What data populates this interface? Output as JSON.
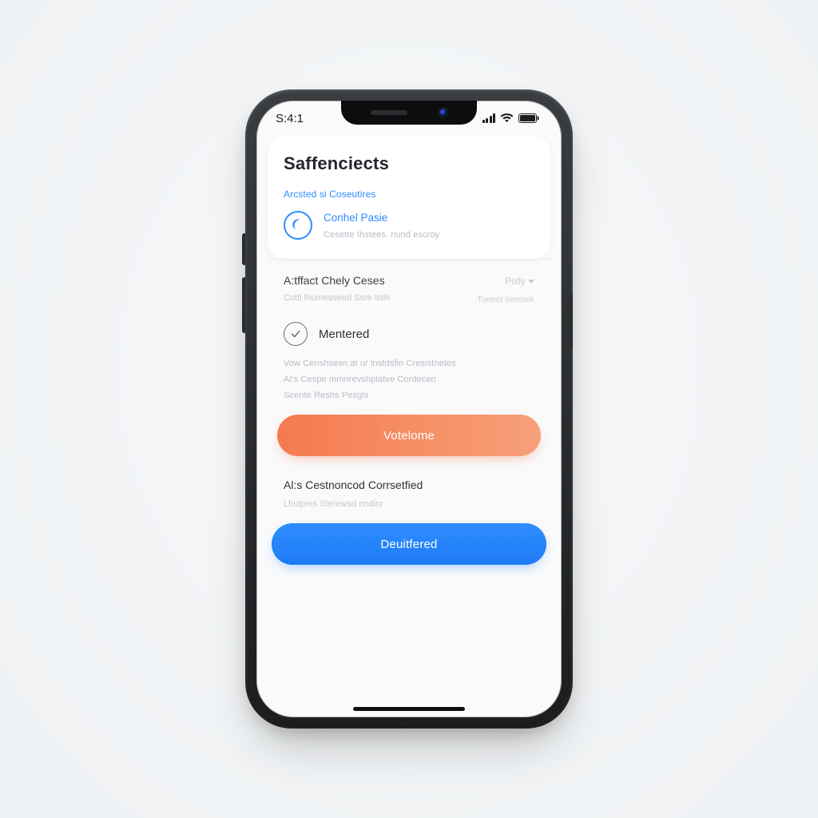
{
  "status_bar": {
    "time": "S:4:1"
  },
  "card": {
    "title": "Saffenciects",
    "link_label": "Arcsted si Coseutires",
    "profile": {
      "title": "Conhel Pasie",
      "subtitle": "Cesette Ihstees. nund escroy"
    }
  },
  "section_divider": {
    "left_title": "A:tffact Chely Ceses",
    "left_sub": "Cottl lhumesseed Ssre lstih",
    "right_label": "Polly",
    "right_sub": "Tormet Ineetiek"
  },
  "item_row": {
    "title": "Mentered",
    "details": [
      "Vow Censhsesn aI ur lnstdsfin Cresistnetes",
      "AI's Cespe mmnrevshplatve Cordecen",
      "Scente Reshs Pesgls"
    ]
  },
  "buttons": {
    "primary_label": "Votelome",
    "secondary_label": "Deuitfered"
  },
  "section2": {
    "title": "Al:s Cestnoncod Corrsetfied",
    "subtitle": "Lhulpres Sterewsd ondinr"
  }
}
